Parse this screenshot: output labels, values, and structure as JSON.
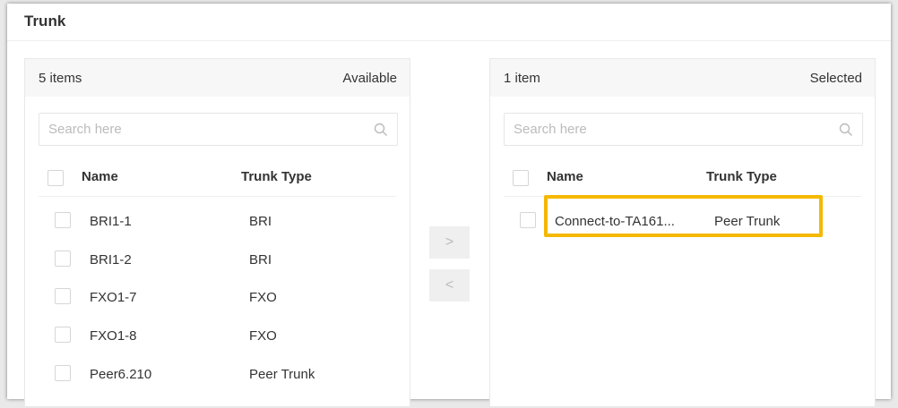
{
  "title": "Trunk",
  "available": {
    "count": "5 items",
    "label": "Available",
    "search_placeholder": "Search here",
    "columns": [
      "Name",
      "Trunk Type"
    ],
    "rows": [
      {
        "name": "BRI1-1",
        "type": "BRI"
      },
      {
        "name": "BRI1-2",
        "type": "BRI"
      },
      {
        "name": "FXO1-7",
        "type": "FXO"
      },
      {
        "name": "FXO1-8",
        "type": "FXO"
      },
      {
        "name": "Peer6.210",
        "type": "Peer Trunk"
      }
    ]
  },
  "selected": {
    "count": "1 item",
    "label": "Selected",
    "search_placeholder": "Search here",
    "columns": [
      "Name",
      "Trunk Type"
    ],
    "rows": [
      {
        "name": "Connect-to-TA161...",
        "type": "Peer Trunk"
      }
    ]
  },
  "buttons": {
    "move_right": ">",
    "move_left": "<"
  },
  "colors": {
    "highlight": "#f5b800"
  }
}
